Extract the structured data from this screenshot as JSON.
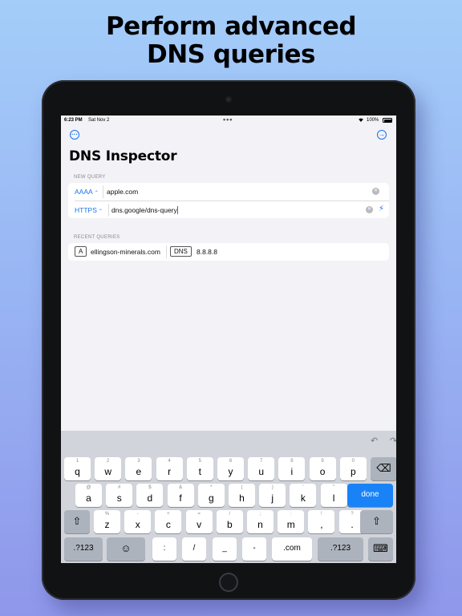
{
  "headline": {
    "line1": "Perform advanced",
    "line2": "DNS queries"
  },
  "status_bar": {
    "time": "6:23 PM",
    "date": "Sat Nov 2",
    "dots": "•••",
    "battery": "100%"
  },
  "nav": {
    "left_icon": "ellipsis-circle-icon",
    "right_icon": "arrow-right-circle-icon"
  },
  "app": {
    "title": "DNS Inspector",
    "new_query_label": "NEW QUERY",
    "record_type": "AAAA",
    "domain_value": "apple.com",
    "transport": "HTTPS",
    "resolver_value": "dns.google/dns-query",
    "recent_label": "RECENT QUERIES",
    "recent": [
      {
        "type": "A",
        "domain": "ellingson-minerals.com",
        "transport": "DNS",
        "server": "8.8.8.8"
      }
    ]
  },
  "keyboard": {
    "row1": [
      [
        "1",
        "q"
      ],
      [
        "2",
        "w"
      ],
      [
        "3",
        "e"
      ],
      [
        "4",
        "r"
      ],
      [
        "5",
        "t"
      ],
      [
        "6",
        "y"
      ],
      [
        "7",
        "u"
      ],
      [
        "8",
        "i"
      ],
      [
        "9",
        "o"
      ],
      [
        "0",
        "p"
      ]
    ],
    "row2": [
      [
        "@",
        "a"
      ],
      [
        "#",
        "s"
      ],
      [
        "$",
        "d"
      ],
      [
        "&",
        "f"
      ],
      [
        "*",
        "g"
      ],
      [
        "(",
        "h"
      ],
      [
        ")",
        "j"
      ],
      [
        "'",
        "k"
      ],
      [
        "\"",
        "l"
      ]
    ],
    "row3": [
      [
        "%",
        "z"
      ],
      [
        "-",
        "x"
      ],
      [
        "+",
        "c"
      ],
      [
        "=",
        "v"
      ],
      [
        "/",
        "b"
      ],
      [
        ";",
        "n"
      ],
      [
        ":",
        "m"
      ],
      [
        "!",
        ","
      ],
      [
        "?",
        "."
      ]
    ],
    "done": "done",
    "numbers": ".?123",
    "colon": ":",
    "slash": "/",
    "underscore": "_",
    "dash": "-",
    "dotcom": ".com",
    "icons": {
      "undo": "undo-icon",
      "redo": "redo-icon",
      "backspace": "backspace-icon",
      "shift": "shift-icon",
      "emoji": "emoji-icon",
      "dismiss": "keyboard-dismiss-icon"
    }
  },
  "colors": {
    "accent": "#1a73e8",
    "done_key": "#1a82f7",
    "background_top": "#a4cdf9",
    "background_bottom": "#8f97ea"
  }
}
